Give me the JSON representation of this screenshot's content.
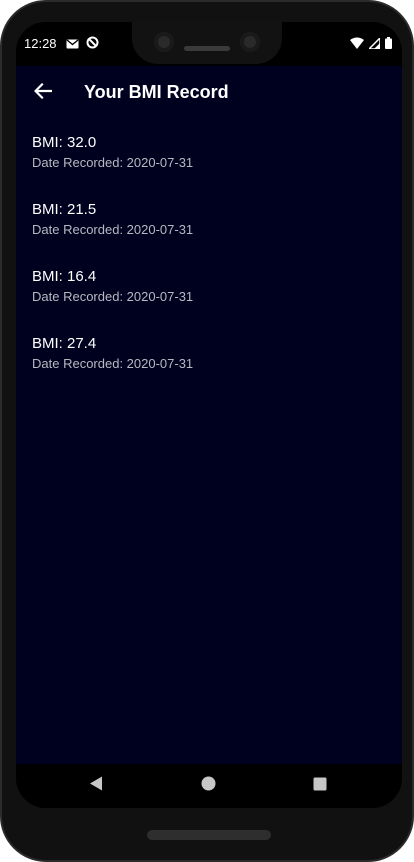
{
  "status_bar": {
    "time": "12:28",
    "left_icons": [
      "mail-icon",
      "sync-icon"
    ],
    "right_icons": [
      "wifi-icon",
      "signal-icon",
      "battery-icon"
    ]
  },
  "app_bar": {
    "title": "Your BMI Record",
    "back_icon": "arrow-back-icon"
  },
  "records": [
    {
      "bmi": "BMI: 32.0",
      "date": "Date Recorded: 2020-07-31"
    },
    {
      "bmi": "BMI: 21.5",
      "date": "Date Recorded: 2020-07-31"
    },
    {
      "bmi": "BMI: 16.4",
      "date": "Date Recorded: 2020-07-31"
    },
    {
      "bmi": "BMI: 27.4",
      "date": "Date Recorded: 2020-07-31"
    }
  ],
  "nav_bar": {
    "buttons": [
      "back-triangle-icon",
      "home-circle-icon",
      "recents-square-icon"
    ]
  },
  "colors": {
    "app_background": "#00001f",
    "text_primary": "#ffffff",
    "text_secondary": "#b8b8c2",
    "device_frame": "#111111"
  }
}
